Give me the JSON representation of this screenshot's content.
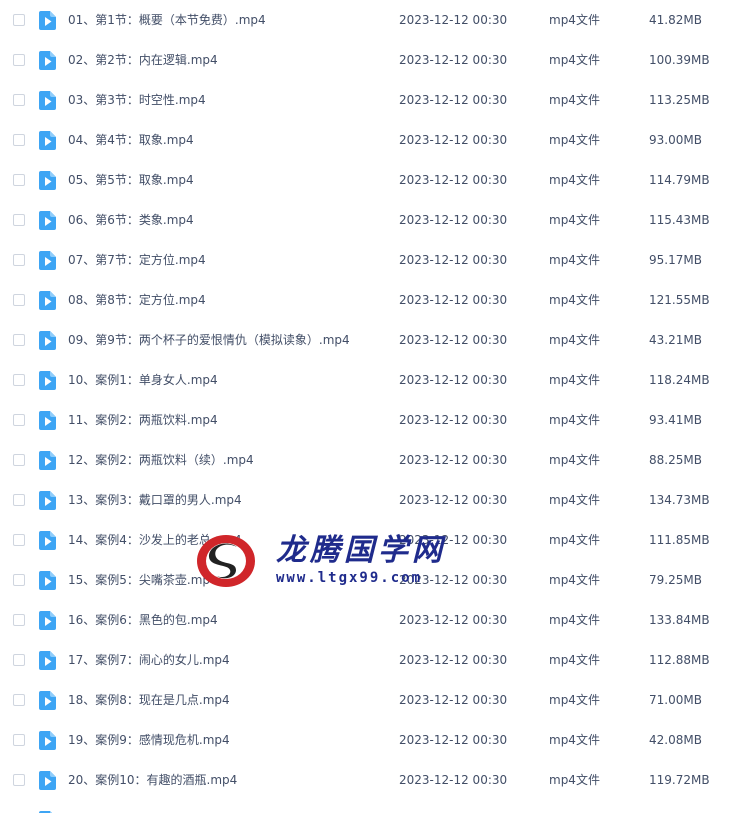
{
  "files": [
    {
      "name": "01、第1节：概要（本节免费）.mp4",
      "date": "2023-12-12 00:30",
      "type": "mp4文件",
      "size": "41.82MB"
    },
    {
      "name": "02、第2节：内在逻辑.mp4",
      "date": "2023-12-12 00:30",
      "type": "mp4文件",
      "size": "100.39MB"
    },
    {
      "name": "03、第3节：时空性.mp4",
      "date": "2023-12-12 00:30",
      "type": "mp4文件",
      "size": "113.25MB"
    },
    {
      "name": "04、第4节：取象.mp4",
      "date": "2023-12-12 00:30",
      "type": "mp4文件",
      "size": "93.00MB"
    },
    {
      "name": "05、第5节：取象.mp4",
      "date": "2023-12-12 00:30",
      "type": "mp4文件",
      "size": "114.79MB"
    },
    {
      "name": "06、第6节：类象.mp4",
      "date": "2023-12-12 00:30",
      "type": "mp4文件",
      "size": "115.43MB"
    },
    {
      "name": "07、第7节：定方位.mp4",
      "date": "2023-12-12 00:30",
      "type": "mp4文件",
      "size": "95.17MB"
    },
    {
      "name": "08、第8节：定方位.mp4",
      "date": "2023-12-12 00:30",
      "type": "mp4文件",
      "size": "121.55MB"
    },
    {
      "name": "09、第9节：两个杯子的爱恨情仇（模拟读象）.mp4",
      "date": "2023-12-12 00:30",
      "type": "mp4文件",
      "size": "43.21MB"
    },
    {
      "name": "10、案例1：单身女人.mp4",
      "date": "2023-12-12 00:30",
      "type": "mp4文件",
      "size": "118.24MB"
    },
    {
      "name": "11、案例2：两瓶饮料.mp4",
      "date": "2023-12-12 00:30",
      "type": "mp4文件",
      "size": "93.41MB"
    },
    {
      "name": "12、案例2：两瓶饮料（续）.mp4",
      "date": "2023-12-12 00:30",
      "type": "mp4文件",
      "size": "88.25MB"
    },
    {
      "name": "13、案例3：戴口罩的男人.mp4",
      "date": "2023-12-12 00:30",
      "type": "mp4文件",
      "size": "134.73MB"
    },
    {
      "name": "14、案例4：沙发上的老总.mp4",
      "date": "2023-12-12 00:30",
      "type": "mp4文件",
      "size": "111.85MB"
    },
    {
      "name": "15、案例5：尖嘴茶壶.mp4",
      "date": "2023-12-12 00:30",
      "type": "mp4文件",
      "size": "79.25MB"
    },
    {
      "name": "16、案例6：黑色的包.mp4",
      "date": "2023-12-12 00:30",
      "type": "mp4文件",
      "size": "133.84MB"
    },
    {
      "name": "17、案例7：闹心的女儿.mp4",
      "date": "2023-12-12 00:30",
      "type": "mp4文件",
      "size": "112.88MB"
    },
    {
      "name": "18、案例8：现在是几点.mp4",
      "date": "2023-12-12 00:30",
      "type": "mp4文件",
      "size": "71.00MB"
    },
    {
      "name": "19、案例9：感情现危机.mp4",
      "date": "2023-12-12 00:30",
      "type": "mp4文件",
      "size": "42.08MB"
    },
    {
      "name": "20、案例10：有趣的酒瓶.mp4",
      "date": "2023-12-12 00:30",
      "type": "mp4文件",
      "size": "119.72MB"
    }
  ],
  "icons": {
    "file": "mp4-file-icon",
    "checkbox": "checkbox"
  },
  "colors": {
    "text": "#424e67",
    "file_icon": "#3ea5f4",
    "watermark": "#1f2b8c",
    "watermark_logo_red": "#d0262a"
  },
  "watermark": {
    "title": "龙腾国学网",
    "url": "www.ltgx99.com"
  }
}
